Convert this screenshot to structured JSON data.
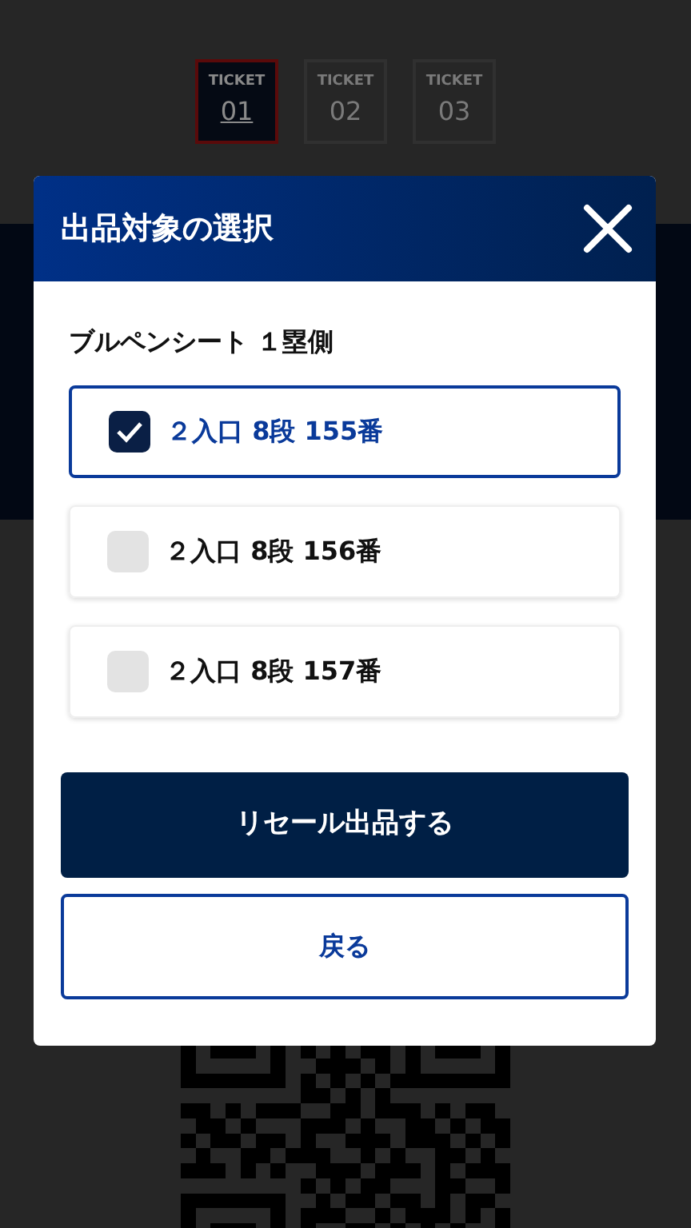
{
  "tickets": [
    {
      "label": "TICKET",
      "number": "01",
      "selected": true
    },
    {
      "label": "TICKET",
      "number": "02",
      "selected": false
    },
    {
      "label": "TICKET",
      "number": "03",
      "selected": false
    }
  ],
  "modal": {
    "title": "出品対象の選択",
    "subtitle": "ブルペンシート １塁側",
    "seats": [
      {
        "label": "２入口 8段 155番",
        "checked": true
      },
      {
        "label": "２入口 8段 156番",
        "checked": false
      },
      {
        "label": "２入口 8段 157番",
        "checked": false
      }
    ],
    "primary_button": "リセール出品する",
    "back_button": "戻る"
  }
}
